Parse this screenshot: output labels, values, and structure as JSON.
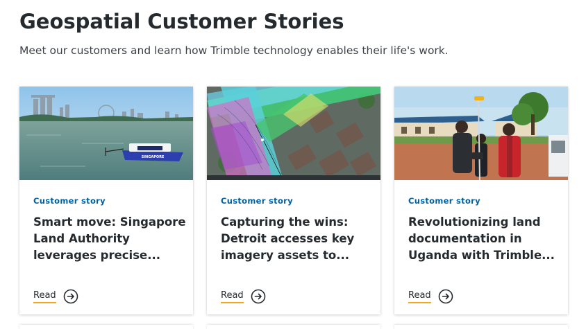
{
  "header": {
    "title": "Geospatial Customer Stories",
    "subtitle": "Meet our customers and learn how Trimble technology enables their life's work."
  },
  "cards": [
    {
      "eyebrow": "Customer story",
      "title_lines": [
        "Smart move: Singapore",
        "Land Authority",
        "leverages precise..."
      ],
      "read_label": "Read",
      "image_icon": "singapore-harbor-survey-boat",
      "boat_label": "SINGAPORE"
    },
    {
      "eyebrow": "Customer story",
      "title_lines": [
        "Capturing the wins:",
        "Detroit accesses key",
        "imagery assets to..."
      ],
      "read_label": "Read",
      "image_icon": "detroit-aerial-pointcloud-map"
    },
    {
      "eyebrow": "Customer story",
      "title_lines": [
        "Revolutionizing land",
        "documentation in",
        "Uganda with Trimble..."
      ],
      "read_label": "Read",
      "image_icon": "uganda-field-surveyors"
    }
  ],
  "colors": {
    "eyebrow": "#005f9e",
    "title": "#252a2e",
    "read_underline": "#f1a81e"
  }
}
